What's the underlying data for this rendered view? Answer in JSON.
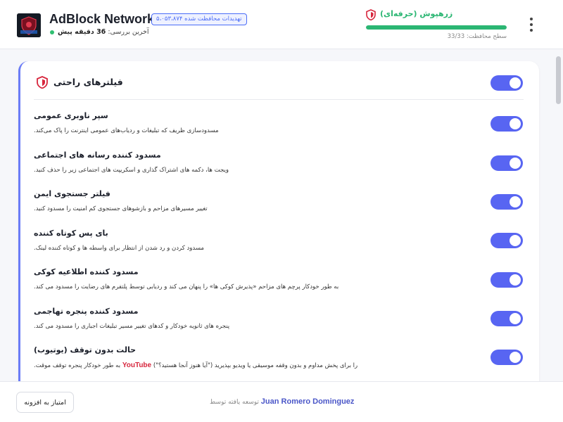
{
  "header": {
    "app_title": "AdBlock Network",
    "threat_badge": "تهدیدات محافظت شده ۵،۰۵۳،۸۷۴",
    "last_check_label": "آخرین بررسی:",
    "last_check_value": "36 دقیقه پیش",
    "protection_name": "زرهپوش (حرفه‌ای)",
    "protection_level_label": "سطح محافظت:",
    "protection_level_value": "33/33",
    "protection_fraction": 1.0
  },
  "card": {
    "title": "فیلترهای راحتی"
  },
  "filters": [
    {
      "title": "سپر ناوبری عمومی",
      "description": "مسدودسازی ظریف که تبلیغات و ردیاب‌های عمومی اینترنت را پاک می‌کند."
    },
    {
      "title": "مسدود کننده رسانه های اجتماعی",
      "description": "ویجت ها، دکمه های اشتراک گذاری و اسکریپت های اجتماعی زیر را حذف کنید."
    },
    {
      "title": "فیلتر جستجوی ایمن",
      "description": "تغییر مسیرهای مزاحم و بازشوهای جستجوی کم امنیت را مسدود کنید."
    },
    {
      "title": "بای پس کوتاه کننده",
      "description": "مسدود کردن و رد شدن از انتظار برای واسطه ها و کوتاه کننده لینک."
    },
    {
      "title": "مسدود کننده اطلاعیه کوکی",
      "description": "به طور خودکار پرچم های مزاحم «پذیرش کوکی ها» را پنهان می کند و ردیابی توسط پلتفرم های رضایت را مسدود می کند."
    },
    {
      "title": "مسدود کننده پنجره تهاجمی",
      "description": "پنجره های ثانویه خودکار و کدهای تغییر مسیر تبلیغات اجباری را مسدود می کند."
    },
    {
      "title": "حالت بدون توقف (یوتیوب)",
      "desc_pre": "را برای پخش مداوم و بدون وقفه موسیقی یا ویدیو بپذیرید (\"آیا هنوز آنجا هستید؟\")",
      "desc_brand": "YouTube",
      "desc_post": "به طور خودکار پنجره توقف موقت."
    }
  ],
  "footer": {
    "rate_label": "امتیاز به افزونه",
    "developed_by": "توسعه یافته توسط",
    "developer": "Juan Romero Dominguez"
  },
  "colors": {
    "accent": "#5865f2",
    "protection_green": "#2bb673",
    "shield_red": "#d7263d"
  }
}
